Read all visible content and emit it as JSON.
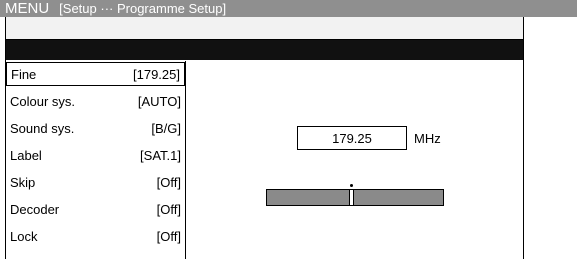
{
  "title_bar": {
    "menu_label": "MENU",
    "path": "[Setup ··· Programme Setup]"
  },
  "settings": [
    {
      "label": "Fine",
      "value": "[179.25]",
      "selected": true
    },
    {
      "label": "Colour sys.",
      "value": "[AUTO]"
    },
    {
      "label": "Sound sys.",
      "value": "[B/G]"
    },
    {
      "label": "Label",
      "value": "[SAT.1]"
    },
    {
      "label": "Skip",
      "value": "[Off]"
    },
    {
      "label": "Decoder",
      "value": "[Off]"
    },
    {
      "label": "Lock",
      "value": "[Off]"
    }
  ],
  "frequency": {
    "value": "179.25",
    "unit": "MHz"
  },
  "tuning": {
    "position_fraction": 0.48
  },
  "colors": {
    "title_bar_bg": "#8f8f8f",
    "header_bar_bg": "#111111",
    "tuning_bar_bg": "#8a8a8a"
  }
}
